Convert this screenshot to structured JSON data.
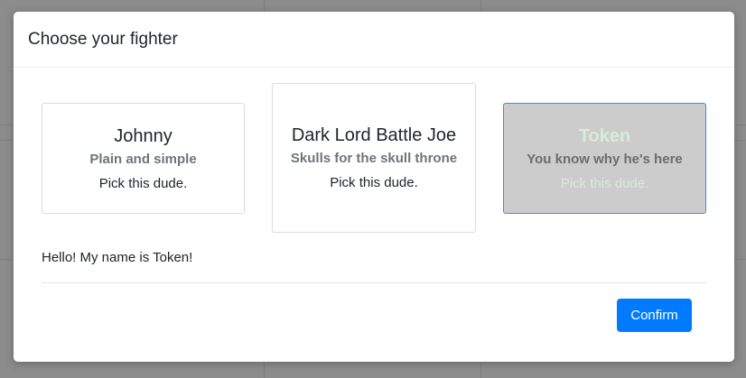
{
  "modal": {
    "title": "Choose your fighter",
    "cards": [
      {
        "title": "Johnny",
        "subtitle": "Plain and simple",
        "action": "Pick this dude."
      },
      {
        "title": "Dark Lord Battle Joe",
        "subtitle": "Skulls for the skull throne",
        "action": "Pick this dude."
      },
      {
        "title": "Token",
        "subtitle": "You know why he's here",
        "action": "Pick this dude.",
        "selected": true
      }
    ],
    "message": "Hello! My name is Token!",
    "confirm_label": "Confirm"
  },
  "colors": {
    "primary": "#007bff",
    "selected_card_bg": "#cccccc",
    "selected_card_border": "#3b8ded",
    "backdrop": "#8c8c8c"
  }
}
